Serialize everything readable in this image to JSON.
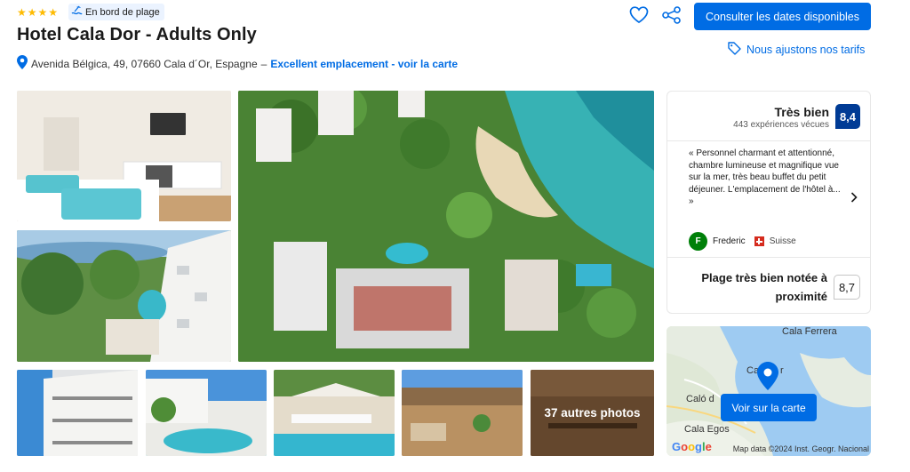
{
  "header": {
    "star_rating": 4,
    "beach_badge": "En bord de plage",
    "title": "Hotel Cala Dor - Adults Only",
    "address": "Avenida Bélgica, 49, 07660 Cala d´Or, Espagne",
    "address_separator": "–",
    "location_link": "Excellent emplacement - voir la carte",
    "cta_label": "Consulter les dates disponibles",
    "price_match": "Nous ajustons nos tarifs",
    "icons": [
      "pin-icon",
      "heart-icon",
      "share-icon",
      "tag-icon",
      "beach-icon"
    ]
  },
  "gallery": {
    "more_photos_label": "37 autres photos"
  },
  "review": {
    "rating_label": "Très bien",
    "review_count": "443 expériences vécues",
    "score": "8,4",
    "quote": "« Personnel charmant et attentionné, chambre lumineuse et magnifique vue sur la mer, très beau buffet du petit déjeuner. L'emplacement de l'hôtel à... »",
    "reviewer_initial": "F",
    "reviewer_name": "Frederic",
    "reviewer_country": "Suisse",
    "beach_label": "Plage très bien notée à proximité",
    "beach_score": "8,7"
  },
  "map": {
    "button_label": "Voir sur la carte",
    "labels": {
      "cala_ferrera": "Cala Ferrera",
      "cala_dor_partial": "Ca",
      "cala_dor_tail": "r",
      "calo_partial": "Caló d",
      "cala_egos": "Cala Egos",
      "google": "Google"
    },
    "credit": "Map data ©2024 Inst. Geogr. Nacional"
  },
  "colors": {
    "accent": "#006ce4",
    "score_bg": "#003b95",
    "star": "#febb02",
    "avatar": "#008009"
  }
}
